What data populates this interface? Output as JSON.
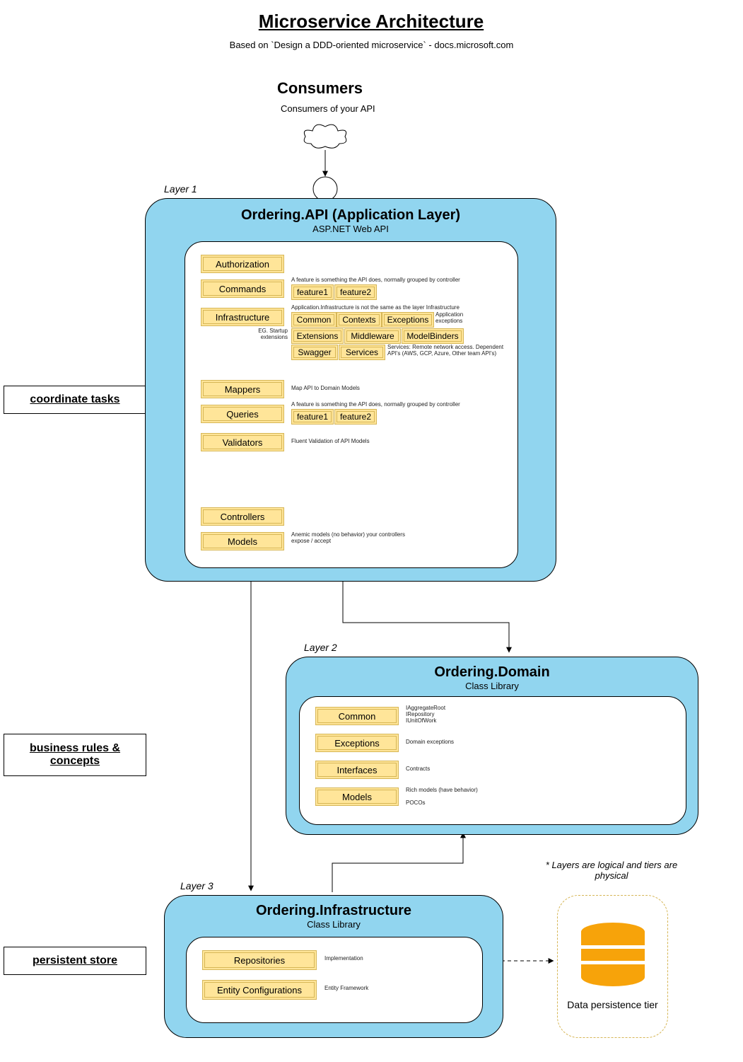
{
  "title": "Microservice Architecture",
  "subtitle": "Based on `Design a DDD-oriented microservice` - docs.microsoft.com",
  "consumers": {
    "heading": "Consumers",
    "sub": "Consumers of your API"
  },
  "side": {
    "coord": "coordinate tasks",
    "biz": "business rules & concepts",
    "store": "persistent store"
  },
  "layer1": {
    "label": "Layer 1",
    "title": "Ordering.API (Application Layer)",
    "sub": "ASP.NET Web API",
    "rows": {
      "auth": "Authorization",
      "commands": {
        "label": "Commands",
        "note": "A feature is something the API does, normally grouped by controller",
        "chips": [
          "feature1",
          "feature2"
        ]
      },
      "infra": {
        "label": "Infrastructure",
        "note": "Application.Infrastructure is not the same as the layer Infrastructure",
        "chips1": [
          "Common",
          "Contexts",
          "Exceptions"
        ],
        "chips1_note": "Application exceptions",
        "chips2": [
          "Extensions",
          "Middleware",
          "ModelBinders"
        ],
        "left_note": "EG. Startup extensions",
        "chips3": [
          "Swagger",
          "Services"
        ],
        "chips3_note": "Services: Remote network access. Dependent API's (AWS, GCP, Azure, Other team API's)"
      },
      "mappers": {
        "label": "Mappers",
        "note": "Map API to Domain Models"
      },
      "queries": {
        "label": "Queries",
        "note": "A feature is something the API does, normally grouped by controller",
        "chips": [
          "feature1",
          "feature2"
        ]
      },
      "validators": {
        "label": "Validators",
        "note": "Fluent Validation of API Models"
      },
      "controllers": "Controllers",
      "models": {
        "label": "Models",
        "note": "Anemic models (no behavior) your controllers expose / accept"
      }
    }
  },
  "layer2": {
    "label": "Layer 2",
    "title": "Ordering.Domain",
    "sub": "Class Library",
    "rows": {
      "common": {
        "label": "Common",
        "note": "IAggregateRoot\nIRepository\nIUnitOfWork"
      },
      "exceptions": {
        "label": "Exceptions",
        "note": "Domain exceptions"
      },
      "interfaces": {
        "label": "Interfaces",
        "note": "Contracts"
      },
      "models": {
        "label": "Models",
        "note": "Rich models (have behavior)\n\nPOCOs"
      }
    }
  },
  "layer3": {
    "label": "Layer 3",
    "title": "Ordering.Infrastructure",
    "sub": "Class Library",
    "rows": {
      "repos": {
        "label": "Repositories",
        "note": "Implementation"
      },
      "entity": {
        "label": "Entity Configurations",
        "note": "Entity Framework"
      }
    }
  },
  "datastore": {
    "caption": "Data persistence tier",
    "footnote": "* Layers are logical and tiers are physical"
  }
}
